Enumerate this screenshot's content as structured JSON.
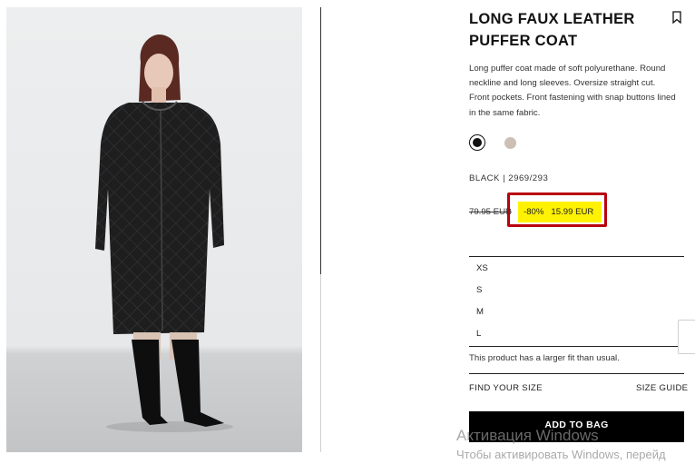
{
  "product": {
    "title_line1": "LONG FAUX LEATHER",
    "title_line2": "PUFFER COAT",
    "description": "Long puffer coat made of soft polyurethane. Round neckline and long sleeves. Oversize straight cut. Front pockets. Front fastening with snap buttons lined in the same fabric.",
    "color_code": "BLACK | 2969/293",
    "colors": [
      {
        "name": "black",
        "hex": "#111111",
        "selected": true
      },
      {
        "name": "beige",
        "hex": "#cdbfb3",
        "selected": false
      }
    ]
  },
  "price": {
    "old": "79.95 EUR",
    "discount": "-80%",
    "current": "15.99 EUR"
  },
  "sizes": [
    "XS",
    "S",
    "M",
    "L"
  ],
  "fit_note": "This product has a larger fit than usual.",
  "links": {
    "find_size": "FIND YOUR SIZE",
    "size_guide": "SIZE GUIDE"
  },
  "cta": {
    "add_to_bag": "ADD TO BAG"
  },
  "os_watermark": {
    "line1": "Активация Windows",
    "line2": "Чтобы активировать Windows, перейд"
  },
  "icons": {
    "bookmark": "bookmark-icon"
  },
  "colors_ui": {
    "sale_bg": "#fff200",
    "highlight_border": "#b8000f"
  }
}
